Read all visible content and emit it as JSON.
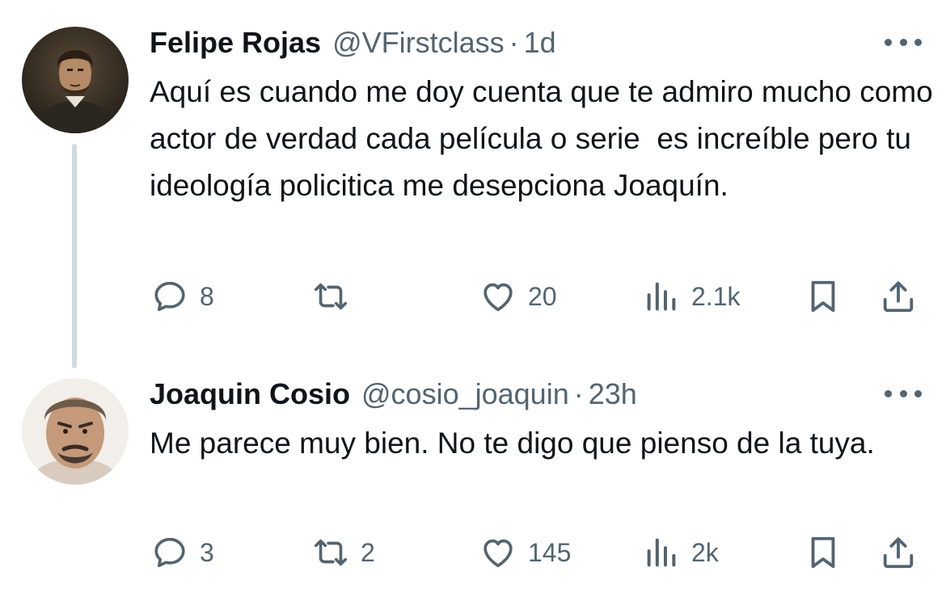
{
  "tweets": [
    {
      "display_name": "Felipe Rojas",
      "handle": "@VFirstclass",
      "separator": "·",
      "time": "1d",
      "text": "Aquí es cuando me doy cuenta que te admiro mucho como actor de verdad cada película o serie  es increíble pero tu ideología policitica me desepciona Joaquín.",
      "replies": "8",
      "retweets": "",
      "likes": "20",
      "views": "2.1k"
    },
    {
      "display_name": "Joaquin Cosio",
      "handle": "@cosio_joaquin",
      "separator": "·",
      "time": "23h",
      "text": "Me parece muy bien. No te digo que pienso de la tuya.",
      "replies": "3",
      "retweets": "2",
      "likes": "145",
      "views": "2k"
    }
  ],
  "icons": {
    "reply": "speech-bubble-icon",
    "retweet": "retweet-icon",
    "like": "heart-icon",
    "views": "bar-chart-icon",
    "bookmark": "bookmark-icon",
    "share": "share-icon",
    "more": "more-dots-icon"
  },
  "colors": {
    "text_primary": "#0f1419",
    "text_secondary": "#536471",
    "thread_line": "#cfd9de"
  }
}
